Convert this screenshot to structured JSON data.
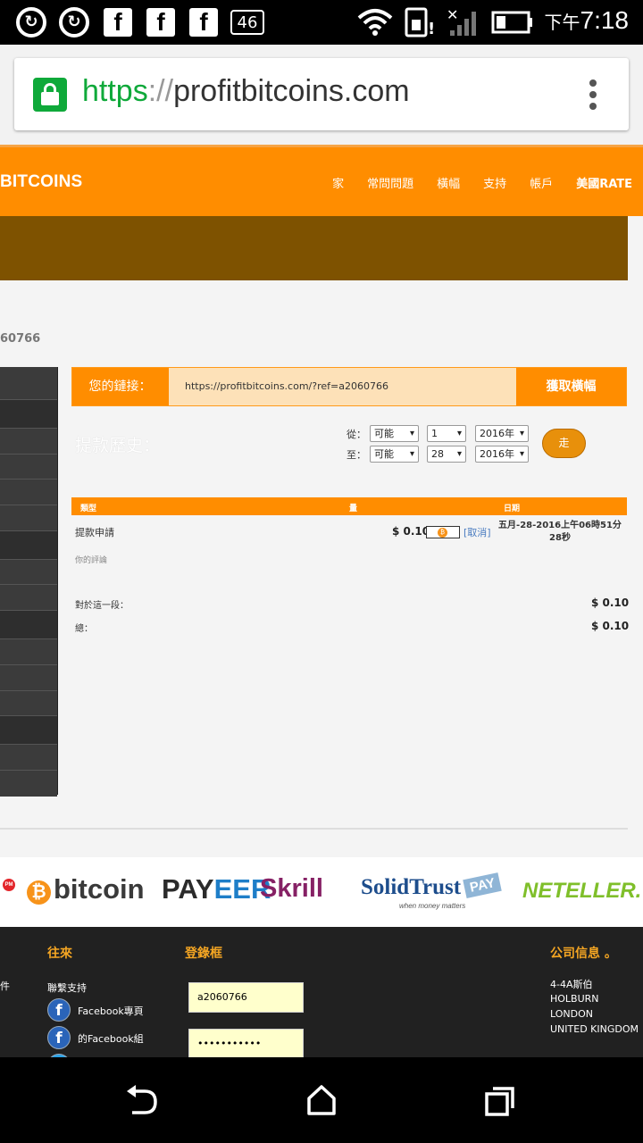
{
  "status_bar": {
    "time_prefix": "下午",
    "time": "7:18",
    "notif_badge": "46"
  },
  "browser": {
    "url_scheme": "https",
    "url_sep": "://",
    "url_host": "profitbitcoins.com"
  },
  "site": {
    "brand": "BITCOINS",
    "nav": [
      "家",
      "常問問題",
      "橫幅",
      "支持",
      "帳戶",
      "美國RATE"
    ],
    "user_id": "60766"
  },
  "referral": {
    "label": "您的鏈接：",
    "link": "https://profitbitcoins.com/?ref=a2060766",
    "button": "獲取橫幅"
  },
  "history": {
    "title": "提款歷史：",
    "from_label": "從：",
    "to_label": "至：",
    "from": {
      "month": "可能",
      "day": "1",
      "year": "2016年"
    },
    "to": {
      "month": "可能",
      "day": "28",
      "year": "2016年"
    },
    "go": "走"
  },
  "table": {
    "headers": {
      "type": "類型",
      "amount": "量",
      "date": "日期"
    },
    "row": {
      "type": "提款申請",
      "amount": "$ 0.10",
      "btc_icon": "₿",
      "cancel": "[取消]",
      "date": "五月-28-2016上午06時51分28秒",
      "comment": "你的評論"
    },
    "summary": [
      {
        "label": "對於這一段：",
        "value": "$ 0.10"
      },
      {
        "label": "總：",
        "value": "$ 0.10"
      }
    ]
  },
  "payment_logos": {
    "pm": "PM",
    "bitcoin": "bitcoin",
    "payeer_a": "PAY",
    "payeer_b": "EER",
    "skrill": "Skrill",
    "solidtrust": "SolidTrust",
    "solidtrust_pay": "PAY",
    "solidtrust_tag": "when money matters",
    "neteller": "NETELLER."
  },
  "footer": {
    "cut_text": "件",
    "col1_head": "往來",
    "support": "聯繫支持",
    "fb_page": "Facebook專頁",
    "fb_group": "的Facebook組",
    "col2_head": "登錄框",
    "username": "a2060766",
    "password": "•••••••••••",
    "col3_head": "公司信息 。",
    "address": [
      "4-4A斯伯",
      "HOLBURN",
      "LONDON",
      "UNITED KINGDOM"
    ]
  },
  "colors": {
    "brand_orange": "#ff8d00",
    "banner_brown": "#7e5200",
    "lock_green": "#0fa93a"
  }
}
